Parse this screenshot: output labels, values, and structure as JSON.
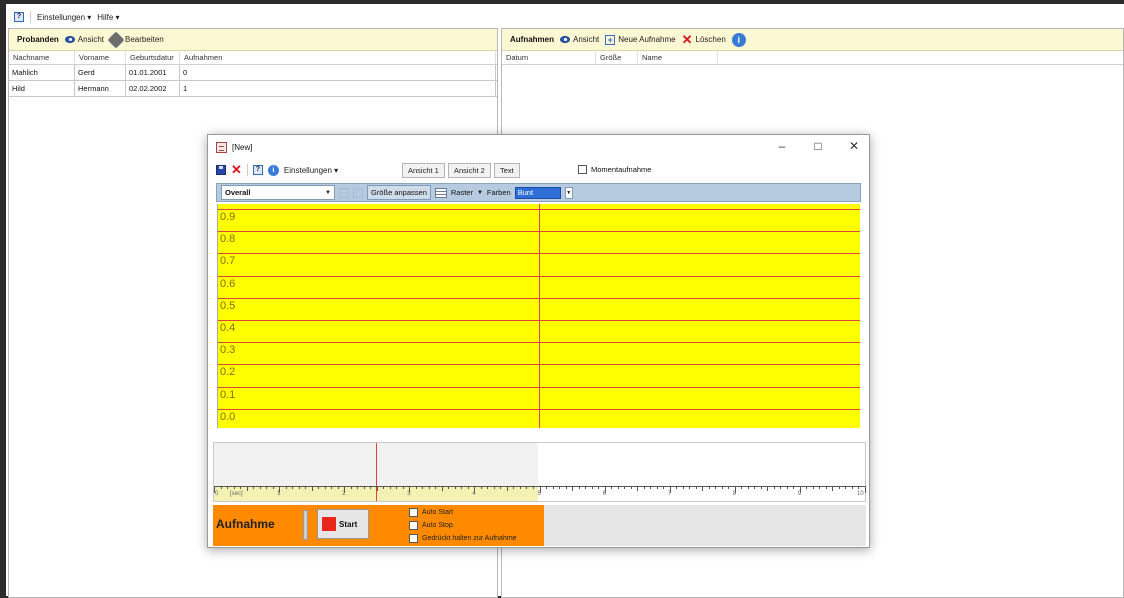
{
  "menubar": {
    "help_icon": "question-icon",
    "items": [
      "Einstellungen ▾",
      "Hilfe ▾"
    ]
  },
  "probanden": {
    "title": "Probanden",
    "view_btn": "Ansicht",
    "edit_btn": "Bearbeiten",
    "columns": [
      "Nachname",
      "Vorname",
      "Geburtsdatur",
      "Aufnahmen"
    ],
    "rows": [
      [
        "Mahlich",
        "Gerd",
        "01.01.2001",
        "0"
      ],
      [
        "Hild",
        "Hermann",
        "02.02.2002",
        "1"
      ]
    ]
  },
  "aufnahmen": {
    "title": "Aufnahmen",
    "view_btn": "Ansicht",
    "new_btn": "Neue Aufnahme",
    "delete_btn": "Löschen",
    "columns": [
      "Datum",
      "Größe",
      "Name"
    ]
  },
  "dialog": {
    "title": "[New]",
    "settings_menu": "Einstellungen ▾",
    "view1": "Ansicht 1",
    "view2": "Ansicht 2",
    "text_btn": "Text",
    "momentaufnahme": "Momentaufnahme",
    "combo_value": "Overall",
    "grow_btn": "Größe anpassen",
    "raster": "Raster",
    "farben_label": "Farben",
    "farben_value": "Bunt",
    "y_labels": [
      "0.9",
      "0.8",
      "0.7",
      "0.6",
      "0.5",
      "0.4",
      "0.3",
      "0.2",
      "0.1",
      "0.0"
    ],
    "timeline_numbers": [
      "0",
      "[sec]",
      "1",
      "2",
      "3",
      "4",
      "5",
      "6",
      "7",
      "8",
      "9",
      "10"
    ],
    "rec_label": "Aufnahme",
    "start_label": "Start",
    "options": [
      "Auto Start",
      "Auto Stop",
      "Gedrückt halten zur Aufnahme"
    ]
  },
  "colors": {
    "plot_bg": "#ffff00",
    "plot_line": "#e0453a",
    "record_bar": "#ff8a00",
    "panel_toolbar": "#fdf8d4",
    "chart_toolbar": "#b7cbe0"
  }
}
